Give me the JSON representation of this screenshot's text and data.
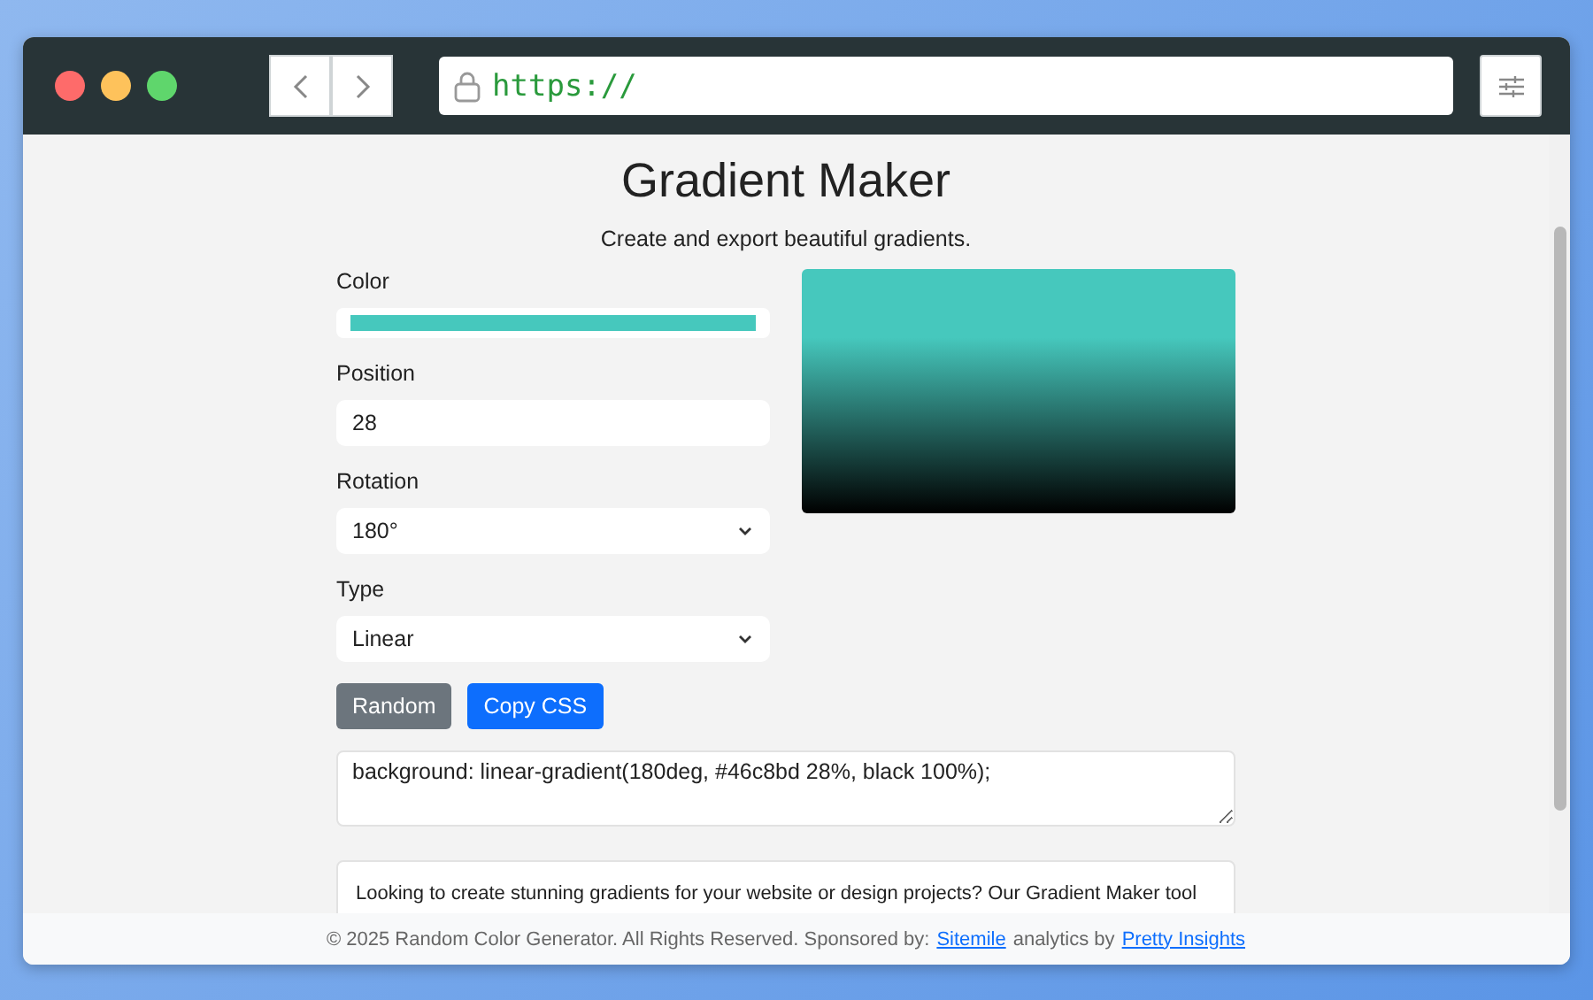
{
  "browser": {
    "url": "https://"
  },
  "page": {
    "title": "Gradient Maker",
    "subtitle": "Create and export beautiful gradients.",
    "color": {
      "label": "Color",
      "color": "#46c8bd"
    },
    "position": {
      "label": "Position",
      "value": "28"
    },
    "rotation": {
      "label": "Rotation",
      "value": "180°"
    },
    "type": {
      "label": "Type",
      "value": "Linear"
    },
    "buttons": [
      {
        "label": "Random",
        "kind": "secondary"
      },
      {
        "label": "Copy CSS",
        "kind": "primary"
      }
    ],
    "css_output": "background: linear-gradient(180deg, #46c8bd 28%, black 100%);",
    "description": [
      "Looking to create stunning gradients for your website or design projects? Our Gradient Maker tool"
    ]
  },
  "footer": {
    "text": "© 2025 Random Color Generator. All Rights Reserved. Sponsored by:",
    "link_1": "Sitemile",
    "middle": "analytics by",
    "link_2": "Pretty Insights"
  }
}
